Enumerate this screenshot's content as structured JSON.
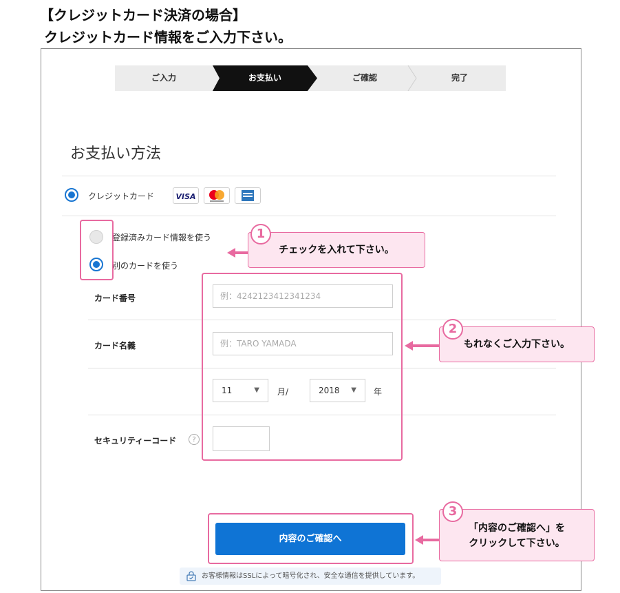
{
  "heading": {
    "line1": "【クレジットカード決済の場合】",
    "line2": "クレジットカード情報をご入力下さい。"
  },
  "steps": [
    {
      "label": "ご入力",
      "active": false
    },
    {
      "label": "お支払い",
      "active": true
    },
    {
      "label": "ご確認",
      "active": false
    },
    {
      "label": "完了",
      "active": false
    }
  ],
  "payment": {
    "title": "お支払い方法",
    "method_label": "クレジットカード",
    "card_brands": [
      "VISA",
      "mastercard",
      "AMERICAN EXPRESS"
    ],
    "option_registered": "登録済みカード情報を使う",
    "option_other": "別のカードを使う"
  },
  "form": {
    "card_number_label": "カード番号",
    "card_number_placeholder": "例：4242123412341234",
    "card_name_label": "カード名義",
    "card_name_placeholder": "例：TARO YAMADA",
    "month_value": "11",
    "month_unit": "月/",
    "year_value": "2018",
    "year_unit": "年",
    "security_label": "セキュリティーコード",
    "help_glyph": "?"
  },
  "callouts": [
    {
      "number": "1",
      "text": "チェックを入れて下さい。"
    },
    {
      "number": "2",
      "text": "もれなくご入力下さい。"
    },
    {
      "number": "3",
      "line1": "「内容のご確認へ」を",
      "line2": "クリックして下さい。"
    }
  ],
  "confirm_button": "内容のご確認へ",
  "ssl_notice": "お客様情報はSSLによって暗号化され、安全な通信を提供しています。",
  "colors": {
    "accent_blue": "#0f74d5",
    "radio_blue": "#1976d2",
    "callout_pink": "#e86aa0",
    "callout_bg": "#fde6f0",
    "active_step": "#111111"
  }
}
